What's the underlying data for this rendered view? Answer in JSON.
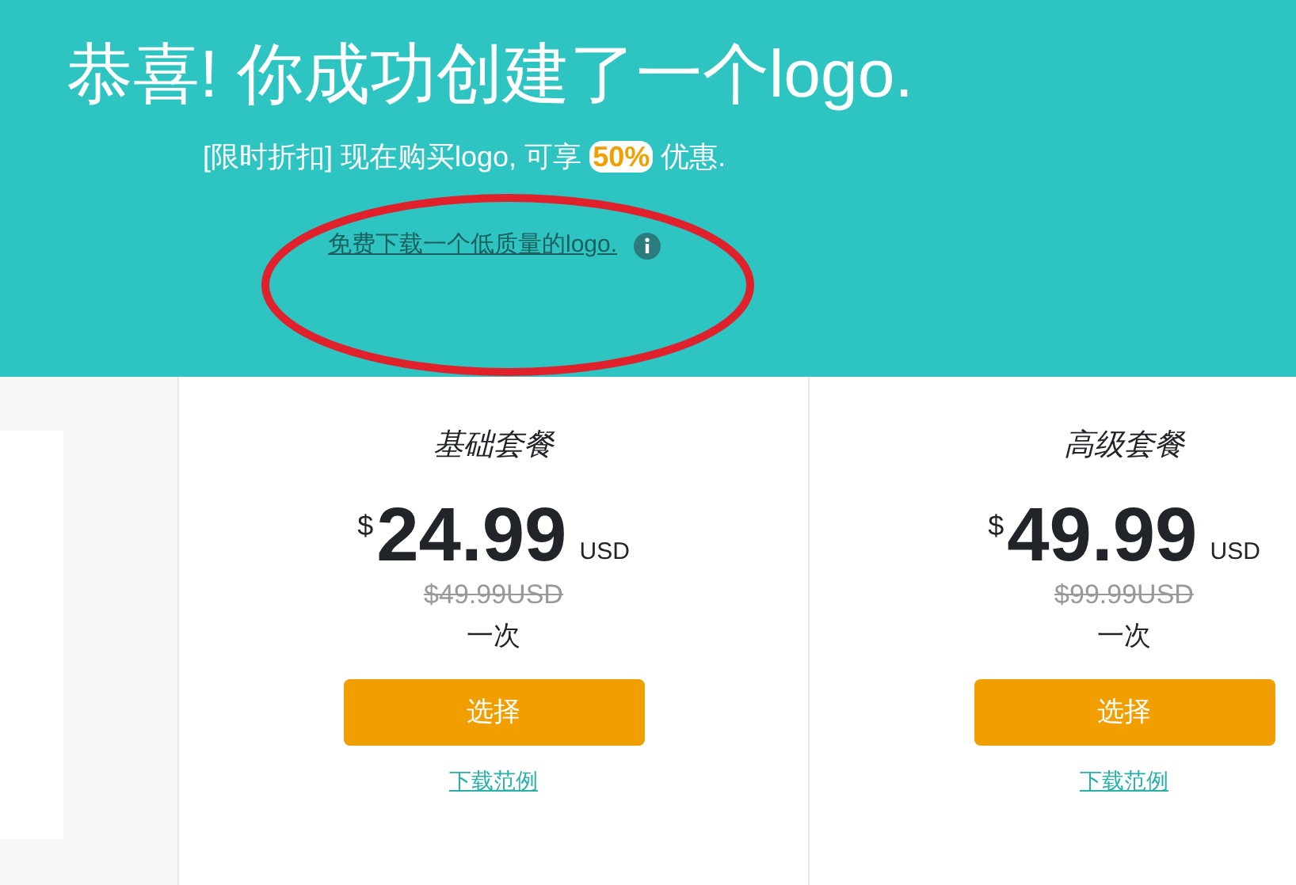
{
  "header": {
    "title": "恭喜! 你成功创建了一个logo.",
    "promo_prefix": "[限时折扣] 现在购买logo, 可享",
    "promo_badge": "50%",
    "promo_suffix": "优惠.",
    "free_link": "免费下载一个低质量的logo."
  },
  "plans": [
    {
      "name": "基础套餐",
      "currency": "$",
      "price": "24.99",
      "unit": "USD",
      "old_price": "$49.99USD",
      "period": "一次",
      "button": "选择",
      "sample_link": "下载范例"
    },
    {
      "name": "高级套餐",
      "currency": "$",
      "price": "49.99",
      "unit": "USD",
      "old_price": "$99.99USD",
      "period": "一次",
      "button": "选择",
      "sample_link": "下载范例"
    }
  ]
}
